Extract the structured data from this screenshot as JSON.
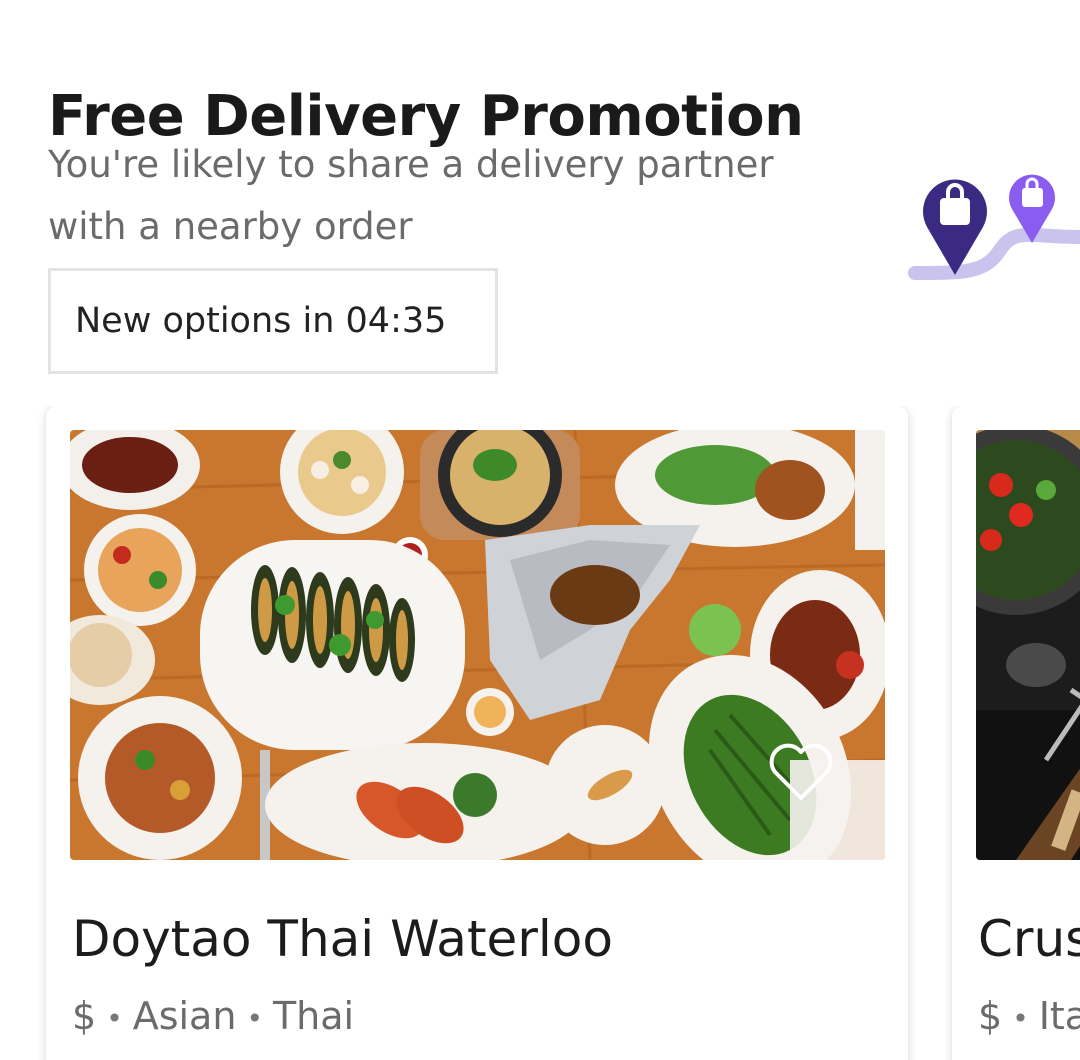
{
  "promo": {
    "title": "Free Delivery Promotion",
    "subtitle": "You're likely to share a delivery partner with a nearby order",
    "countdown": "New options in 04:35"
  },
  "restaurants": [
    {
      "name": "Doytao Thai Waterloo",
      "price": "$",
      "tags": [
        "Asian",
        "Thai"
      ],
      "image": "thai-food-spread-photo"
    },
    {
      "name": "Crus",
      "price": "$",
      "tags": [
        "Ita"
      ],
      "image": "italian-food-photo"
    }
  ],
  "icons": {
    "pin": "shopping-bag-pin-icon",
    "favorite": "heart-outline-icon"
  },
  "colors": {
    "pin_dark": "#3b2a82",
    "pin_light": "#8a5cf0",
    "route": "#c9c3ee",
    "text_secondary": "#6b6b6b"
  }
}
